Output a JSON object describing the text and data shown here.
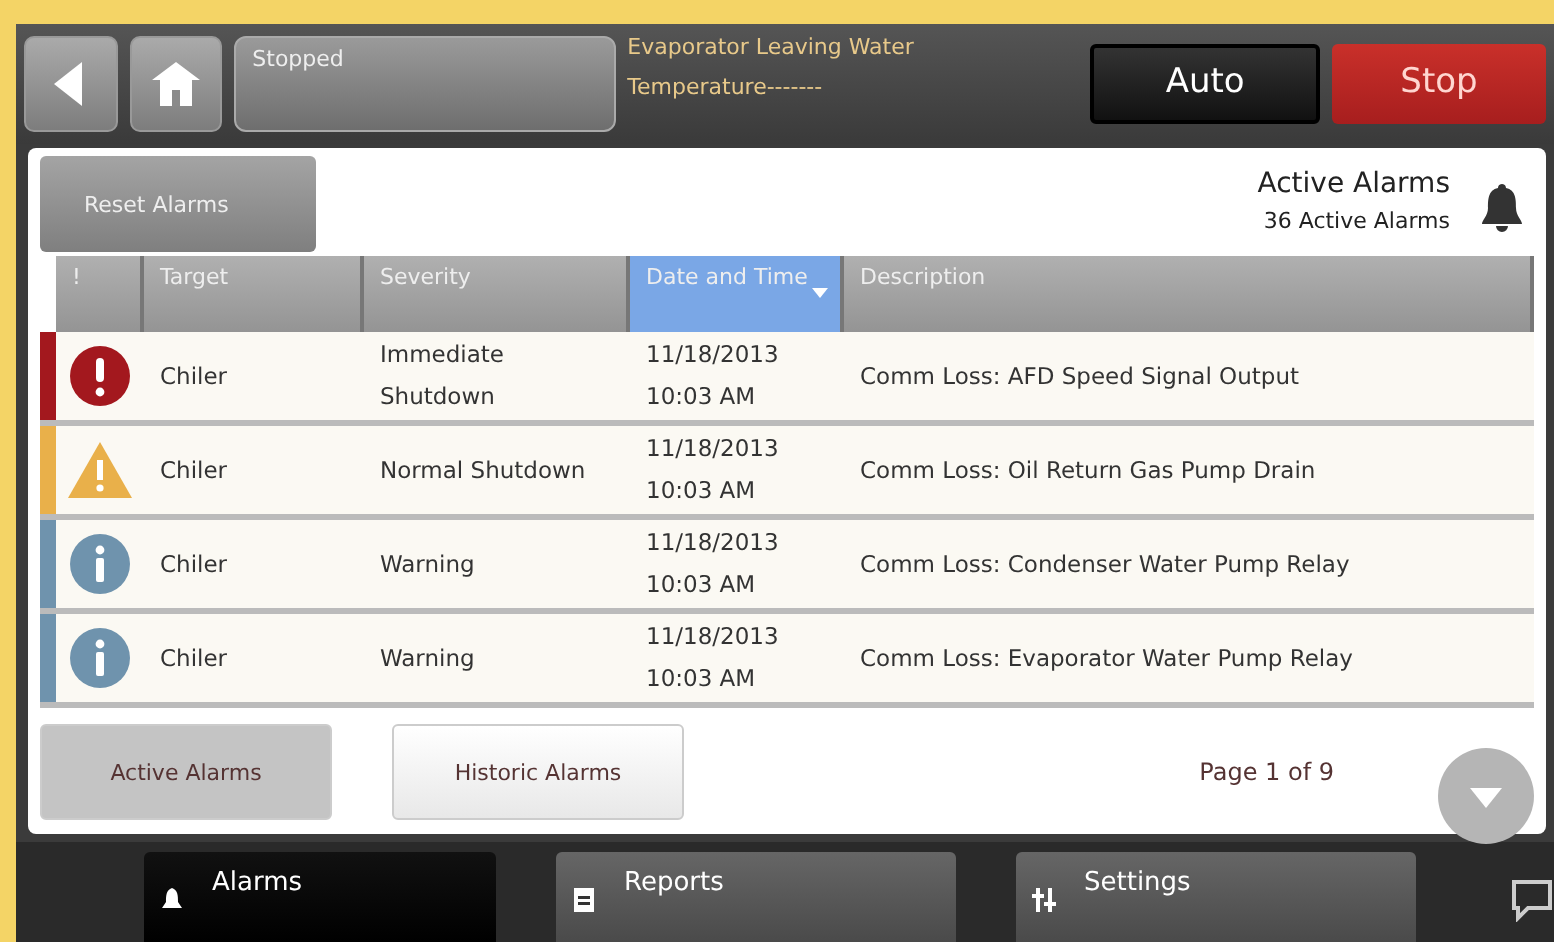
{
  "header": {
    "status": "Stopped",
    "reading": "Evaporator Leaving Water Temperature-------",
    "buttons": [
      {
        "label": "Auto",
        "kind": "auto"
      },
      {
        "label": "Stop",
        "kind": "stop"
      }
    ]
  },
  "panel": {
    "reset_button": "Reset Alarms",
    "title": "Active Alarms",
    "count": "36 Active Alarms"
  },
  "table": {
    "columns": [
      {
        "label": "!",
        "selected": false
      },
      {
        "label": "Target",
        "selected": false
      },
      {
        "label": "Severity",
        "selected": false
      },
      {
        "label": "Date and Time",
        "selected": true
      },
      {
        "label": "Description",
        "selected": false
      }
    ],
    "rows": [
      {
        "kind": "critical",
        "color": "#a3181e",
        "target": "Chiler",
        "severity": "Immediate Shutdown",
        "date": "11/18/2013",
        "time": "10:03 AM",
        "description": "Comm Loss: AFD Speed Signal Output"
      },
      {
        "kind": "caution",
        "color": "#e9b04a",
        "target": "Chiler",
        "severity": "Normal Shutdown",
        "date": "11/18/2013",
        "time": "10:03 AM",
        "description": "Comm Loss: Oil Return Gas Pump Drain"
      },
      {
        "kind": "info",
        "color": "#6f93ad",
        "target": "Chiler",
        "severity": "Warning",
        "date": "11/18/2013",
        "time": "10:03 AM",
        "description": "Comm Loss: Condenser Water Pump Relay"
      },
      {
        "kind": "info",
        "color": "#6f93ad",
        "target": "Chiler",
        "severity": "Warning",
        "date": "11/18/2013",
        "time": "10:03 AM",
        "description": "Comm Loss: Evaporator Water Pump Relay"
      }
    ]
  },
  "tabs": [
    {
      "label": "Active Alarms",
      "selected": true
    },
    {
      "label": "Historic Alarms",
      "selected": false
    }
  ],
  "page": "Page 1 of 9",
  "nav": [
    {
      "label": "Alarms",
      "kind": "alarms",
      "selected": true
    },
    {
      "label": "Reports",
      "kind": "reports",
      "selected": false
    },
    {
      "label": "Settings",
      "kind": "settings",
      "selected": false
    }
  ]
}
